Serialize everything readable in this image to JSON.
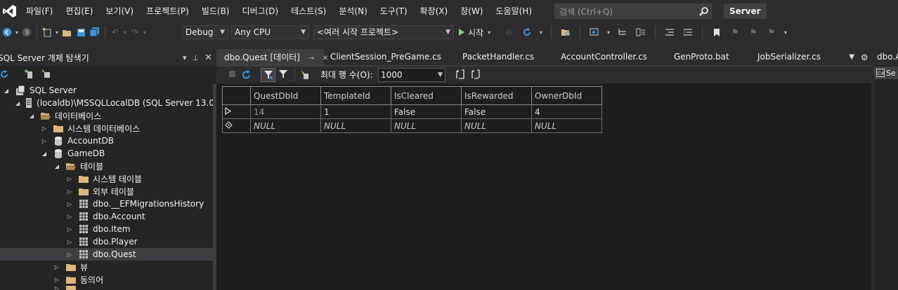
{
  "menu": {
    "items": [
      "파일(F)",
      "편집(E)",
      "보기(V)",
      "프로젝트(P)",
      "빌드(B)",
      "디버그(D)",
      "테스트(S)",
      "분석(N)",
      "도구(T)",
      "확장(X)",
      "창(W)",
      "도움말(H)"
    ],
    "search_placeholder": "검색 (Ctrl+Q)",
    "solution_name": "Server"
  },
  "toolbar": {
    "config": "Debug",
    "platform": "Any CPU",
    "startup_project": "<여러 시작 프로젝트>",
    "start_label": "시작"
  },
  "explorer": {
    "title": "SQL Server 개체 탐색기",
    "tree": [
      {
        "label": "SQL Server",
        "icon": "sql-server-icon",
        "expanded": true
      },
      {
        "label": "(localdb)\\MSSQLLocalDB (SQL Server 13.0.",
        "icon": "server-icon",
        "expanded": true
      },
      {
        "label": "데이터베이스",
        "icon": "folder-open-icon",
        "expanded": true
      },
      {
        "label": "시스템 데이터베이스",
        "icon": "folder-icon",
        "expanded": false
      },
      {
        "label": "AccountDB",
        "icon": "database-icon",
        "expanded": false
      },
      {
        "label": "GameDB",
        "icon": "database-icon",
        "expanded": true
      },
      {
        "label": "테이블",
        "icon": "folder-open-icon",
        "expanded": true
      },
      {
        "label": "시스템 테이블",
        "icon": "folder-icon",
        "expanded": false
      },
      {
        "label": "외부 테이블",
        "icon": "folder-icon",
        "expanded": false
      },
      {
        "label": "dbo.__EFMigrationsHistory",
        "icon": "table-icon",
        "expanded": false
      },
      {
        "label": "dbo.Account",
        "icon": "table-icon",
        "expanded": false
      },
      {
        "label": "dbo.Item",
        "icon": "table-icon",
        "expanded": false
      },
      {
        "label": "dbo.Player",
        "icon": "table-icon",
        "expanded": false
      },
      {
        "label": "dbo.Quest",
        "icon": "table-icon",
        "expanded": false,
        "selected": true
      },
      {
        "label": "뷰",
        "icon": "folder-icon",
        "expanded": false
      },
      {
        "label": "동의어",
        "icon": "folder-icon",
        "expanded": false
      }
    ]
  },
  "tabs": [
    {
      "label": "dbo.Quest [데이터]",
      "active": true
    },
    {
      "label": "ClientSession_PreGame.cs"
    },
    {
      "label": "PacketHandler.cs"
    },
    {
      "label": "AccountController.cs"
    },
    {
      "label": "GenProto.bat"
    },
    {
      "label": "JobSerializer.cs"
    }
  ],
  "right_tab": "dbo.A",
  "right_panel_label": "Se",
  "editor": {
    "max_rows_label": "최대 행 수(O):",
    "max_rows_value": "1000"
  },
  "grid": {
    "columns": [
      "QuestDbId",
      "TemplateId",
      "IsCleared",
      "IsRewarded",
      "OwnerDbId"
    ],
    "rows": [
      [
        "14",
        "1",
        "False",
        "False",
        "4"
      ],
      [
        "NULL",
        "NULL",
        "NULL",
        "NULL",
        "NULL"
      ]
    ]
  }
}
